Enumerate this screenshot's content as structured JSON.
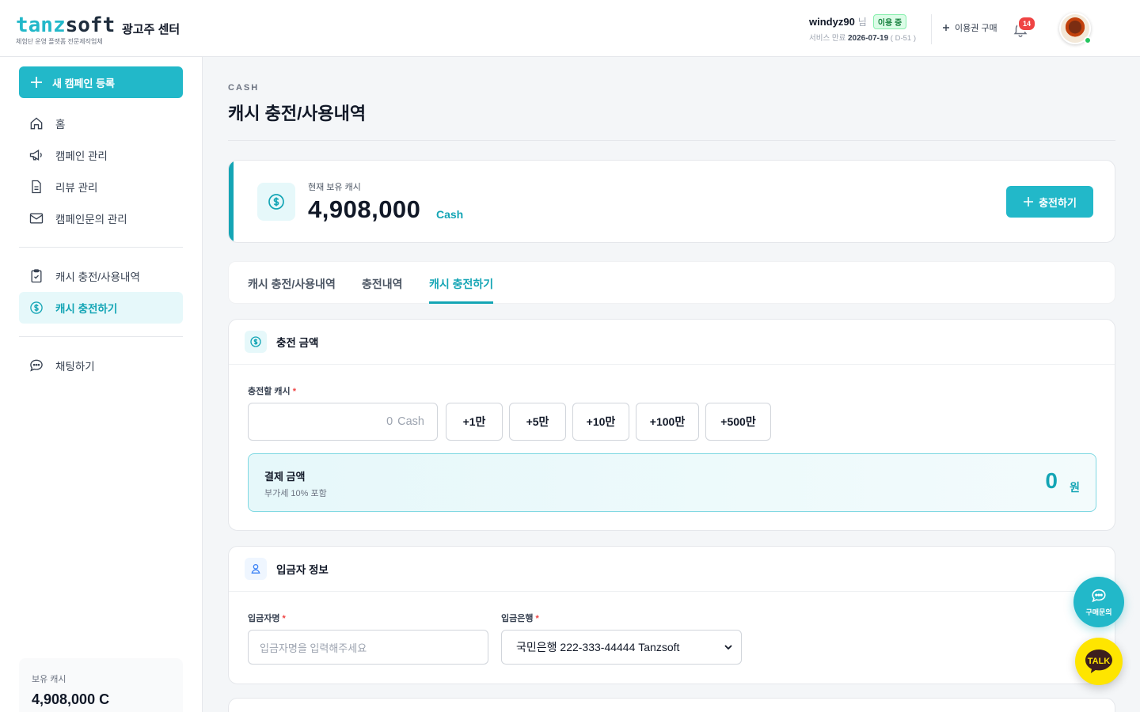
{
  "header": {
    "logo_part1": "tanz",
    "logo_part2": "soft",
    "logo_sub": "체험단 운영 플랫폼 전문제작업체",
    "center_name": "광고주 센터",
    "username": "windyz90",
    "honorific": "님",
    "status_badge": "이용 중",
    "expire_label": "서비스 만료",
    "expire_date": "2026-07-19",
    "expire_dday": "( D-51 )",
    "buy_label": "이용권 구매",
    "notification_count": "14"
  },
  "sidebar": {
    "new_campaign": "새 캠페인 등록",
    "items": [
      {
        "label": "홈",
        "icon": "home-icon"
      },
      {
        "label": "캠페인 관리",
        "icon": "megaphone-icon"
      },
      {
        "label": "리뷰 관리",
        "icon": "document-icon"
      },
      {
        "label": "캠페인문의 관리",
        "icon": "mail-icon"
      },
      {
        "label": "캐시 충전/사용내역",
        "icon": "clipboard-icon"
      },
      {
        "label": "캐시 충전하기",
        "icon": "dollar-icon"
      },
      {
        "label": "채팅하기",
        "icon": "chat-icon"
      }
    ],
    "cash_label": "보유 캐시",
    "cash_value": "4,908,000 C"
  },
  "main": {
    "eyebrow": "CASH",
    "title": "캐시 충전/사용내역",
    "balance": {
      "label": "현재 보유 캐시",
      "value": "4,908,000",
      "unit": "Cash",
      "charge_button": "충전하기"
    },
    "tabs": [
      "캐시 충전/사용내역",
      "충전내역",
      "캐시 충전하기"
    ],
    "active_tab": "캐시 충전하기",
    "charge_section": {
      "title": "충전 금액",
      "field_label": "충전할 캐시",
      "required_mark": "*",
      "input_value": "0",
      "input_unit": "Cash",
      "quick_add": [
        "+1만",
        "+5만",
        "+10만",
        "+100만",
        "+500만"
      ],
      "pay_title": "결제 금액",
      "pay_sub": "부가세 10% 포함",
      "pay_value": "0",
      "pay_unit": "원"
    },
    "depositor_section": {
      "title": "입금자 정보",
      "name_label": "입금자명",
      "name_placeholder": "입금자명을 입력해주세요",
      "bank_label": "입금은행",
      "bank_value": "국민은행 222-333-44444 Tanzsoft",
      "required_mark": "*"
    }
  },
  "floating": {
    "inquiry_label": "구매문의",
    "talk_label": "TALK"
  },
  "colors": {
    "accent": "#22b8c9",
    "accent_dark": "#14a5b5",
    "badge_red": "#ef4444",
    "kakao_yellow": "#fee500"
  }
}
